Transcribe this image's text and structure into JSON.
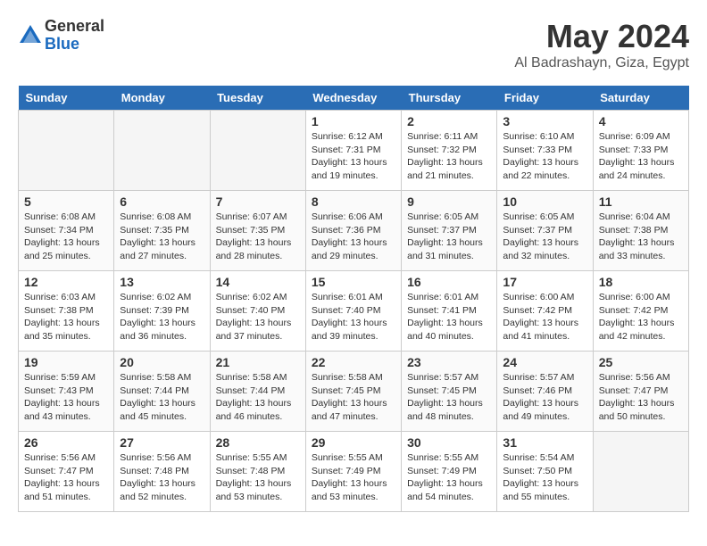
{
  "header": {
    "logo_general": "General",
    "logo_blue": "Blue",
    "month_year": "May 2024",
    "location": "Al Badrashayn, Giza, Egypt"
  },
  "weekdays": [
    "Sunday",
    "Monday",
    "Tuesday",
    "Wednesday",
    "Thursday",
    "Friday",
    "Saturday"
  ],
  "weeks": [
    [
      {
        "day": "",
        "info": ""
      },
      {
        "day": "",
        "info": ""
      },
      {
        "day": "",
        "info": ""
      },
      {
        "day": "1",
        "info": "Sunrise: 6:12 AM\nSunset: 7:31 PM\nDaylight: 13 hours\nand 19 minutes."
      },
      {
        "day": "2",
        "info": "Sunrise: 6:11 AM\nSunset: 7:32 PM\nDaylight: 13 hours\nand 21 minutes."
      },
      {
        "day": "3",
        "info": "Sunrise: 6:10 AM\nSunset: 7:33 PM\nDaylight: 13 hours\nand 22 minutes."
      },
      {
        "day": "4",
        "info": "Sunrise: 6:09 AM\nSunset: 7:33 PM\nDaylight: 13 hours\nand 24 minutes."
      }
    ],
    [
      {
        "day": "5",
        "info": "Sunrise: 6:08 AM\nSunset: 7:34 PM\nDaylight: 13 hours\nand 25 minutes."
      },
      {
        "day": "6",
        "info": "Sunrise: 6:08 AM\nSunset: 7:35 PM\nDaylight: 13 hours\nand 27 minutes."
      },
      {
        "day": "7",
        "info": "Sunrise: 6:07 AM\nSunset: 7:35 PM\nDaylight: 13 hours\nand 28 minutes."
      },
      {
        "day": "8",
        "info": "Sunrise: 6:06 AM\nSunset: 7:36 PM\nDaylight: 13 hours\nand 29 minutes."
      },
      {
        "day": "9",
        "info": "Sunrise: 6:05 AM\nSunset: 7:37 PM\nDaylight: 13 hours\nand 31 minutes."
      },
      {
        "day": "10",
        "info": "Sunrise: 6:05 AM\nSunset: 7:37 PM\nDaylight: 13 hours\nand 32 minutes."
      },
      {
        "day": "11",
        "info": "Sunrise: 6:04 AM\nSunset: 7:38 PM\nDaylight: 13 hours\nand 33 minutes."
      }
    ],
    [
      {
        "day": "12",
        "info": "Sunrise: 6:03 AM\nSunset: 7:38 PM\nDaylight: 13 hours\nand 35 minutes."
      },
      {
        "day": "13",
        "info": "Sunrise: 6:02 AM\nSunset: 7:39 PM\nDaylight: 13 hours\nand 36 minutes."
      },
      {
        "day": "14",
        "info": "Sunrise: 6:02 AM\nSunset: 7:40 PM\nDaylight: 13 hours\nand 37 minutes."
      },
      {
        "day": "15",
        "info": "Sunrise: 6:01 AM\nSunset: 7:40 PM\nDaylight: 13 hours\nand 39 minutes."
      },
      {
        "day": "16",
        "info": "Sunrise: 6:01 AM\nSunset: 7:41 PM\nDaylight: 13 hours\nand 40 minutes."
      },
      {
        "day": "17",
        "info": "Sunrise: 6:00 AM\nSunset: 7:42 PM\nDaylight: 13 hours\nand 41 minutes."
      },
      {
        "day": "18",
        "info": "Sunrise: 6:00 AM\nSunset: 7:42 PM\nDaylight: 13 hours\nand 42 minutes."
      }
    ],
    [
      {
        "day": "19",
        "info": "Sunrise: 5:59 AM\nSunset: 7:43 PM\nDaylight: 13 hours\nand 43 minutes."
      },
      {
        "day": "20",
        "info": "Sunrise: 5:58 AM\nSunset: 7:44 PM\nDaylight: 13 hours\nand 45 minutes."
      },
      {
        "day": "21",
        "info": "Sunrise: 5:58 AM\nSunset: 7:44 PM\nDaylight: 13 hours\nand 46 minutes."
      },
      {
        "day": "22",
        "info": "Sunrise: 5:58 AM\nSunset: 7:45 PM\nDaylight: 13 hours\nand 47 minutes."
      },
      {
        "day": "23",
        "info": "Sunrise: 5:57 AM\nSunset: 7:45 PM\nDaylight: 13 hours\nand 48 minutes."
      },
      {
        "day": "24",
        "info": "Sunrise: 5:57 AM\nSunset: 7:46 PM\nDaylight: 13 hours\nand 49 minutes."
      },
      {
        "day": "25",
        "info": "Sunrise: 5:56 AM\nSunset: 7:47 PM\nDaylight: 13 hours\nand 50 minutes."
      }
    ],
    [
      {
        "day": "26",
        "info": "Sunrise: 5:56 AM\nSunset: 7:47 PM\nDaylight: 13 hours\nand 51 minutes."
      },
      {
        "day": "27",
        "info": "Sunrise: 5:56 AM\nSunset: 7:48 PM\nDaylight: 13 hours\nand 52 minutes."
      },
      {
        "day": "28",
        "info": "Sunrise: 5:55 AM\nSunset: 7:48 PM\nDaylight: 13 hours\nand 53 minutes."
      },
      {
        "day": "29",
        "info": "Sunrise: 5:55 AM\nSunset: 7:49 PM\nDaylight: 13 hours\nand 53 minutes."
      },
      {
        "day": "30",
        "info": "Sunrise: 5:55 AM\nSunset: 7:49 PM\nDaylight: 13 hours\nand 54 minutes."
      },
      {
        "day": "31",
        "info": "Sunrise: 5:54 AM\nSunset: 7:50 PM\nDaylight: 13 hours\nand 55 minutes."
      },
      {
        "day": "",
        "info": ""
      }
    ]
  ]
}
